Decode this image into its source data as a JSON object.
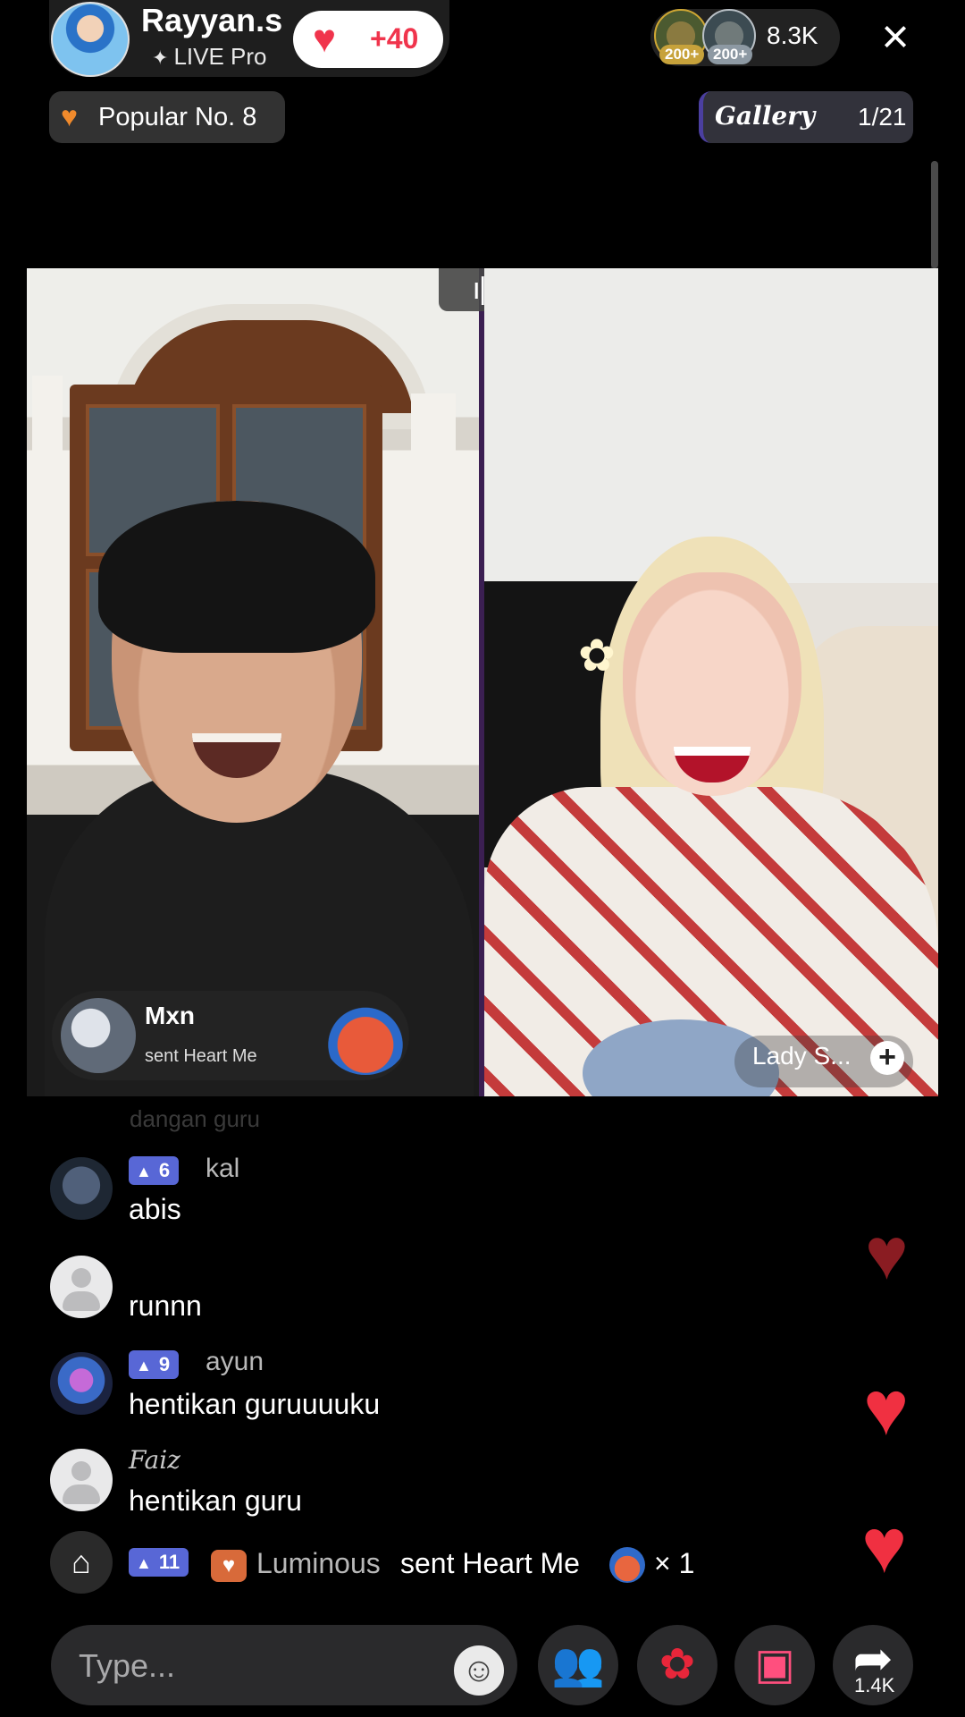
{
  "host": {
    "name": "Rayyan.s",
    "badge": "LIVE Pro",
    "likes": "+40"
  },
  "viewers": {
    "badge_1": "200+",
    "badge_2": "200+",
    "count": "8.3K"
  },
  "close_icon": "×",
  "popular": {
    "label": "Popular No. 8"
  },
  "gallery": {
    "label": "Gallery",
    "count": "1/21"
  },
  "gift_banner": {
    "name": "Mxn",
    "text": "sent Heart Me"
  },
  "guest": {
    "name": "Lady S..."
  },
  "chat": {
    "faded": "dangan guru",
    "messages": [
      {
        "level": "6",
        "user": "kal",
        "text": "abis"
      },
      {
        "level": "",
        "user": "",
        "text": "runnn"
      },
      {
        "level": "9",
        "user": "ayun",
        "text": "hentikan guruuuuku"
      },
      {
        "level": "",
        "user": "Faiz",
        "text": "hentikan guru"
      }
    ],
    "gift_row": {
      "level": "11",
      "user": "Luminous",
      "text": "sent Heart Me",
      "count": "× 1"
    }
  },
  "bottom": {
    "type_placeholder": "Type...",
    "share_count": "1.4K"
  },
  "icons": {
    "close": "close-icon",
    "gift": "gift-icon",
    "emoji": "emoji-icon",
    "guests": "guests-icon",
    "rose": "rose-icon",
    "gift_box": "gift-box-icon",
    "share": "share-icon",
    "heart": "heart-icon"
  },
  "colors": {
    "accent_red": "#f0344c",
    "level_badge": "#5867d6",
    "background": "#000000"
  }
}
